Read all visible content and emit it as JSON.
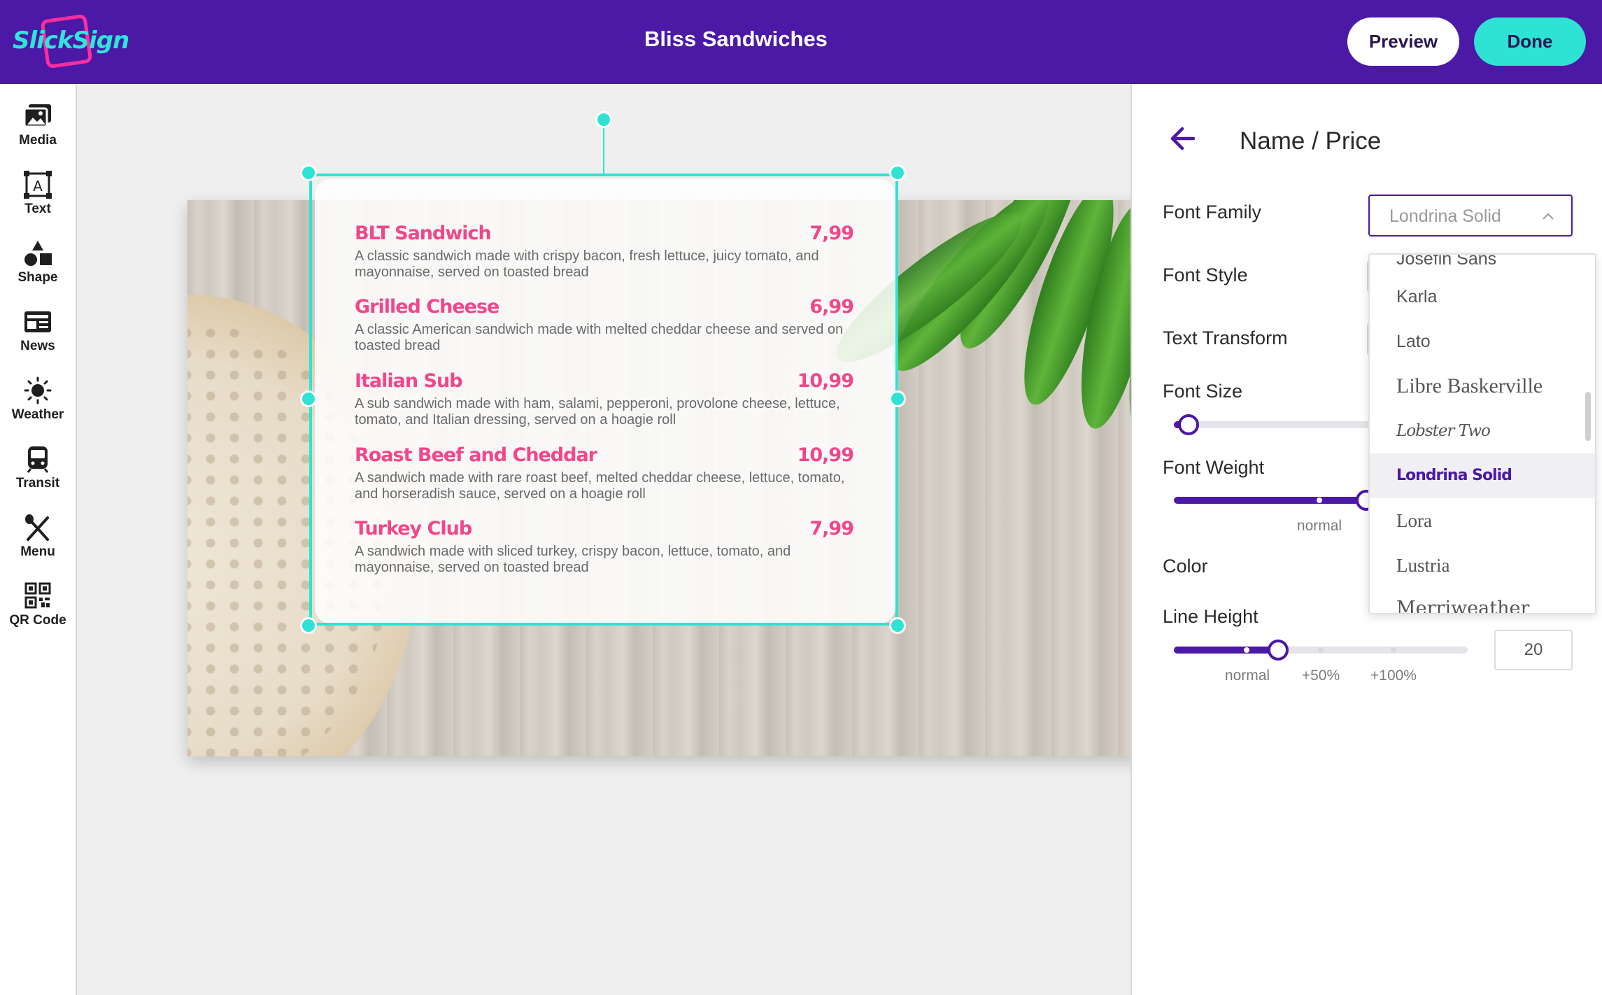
{
  "app": {
    "logo_text": "SlickSign",
    "title": "Bliss Sandwiches",
    "preview_label": "Preview",
    "done_label": "Done"
  },
  "sidebar": {
    "items": [
      {
        "label": "Media",
        "icon": "media-icon"
      },
      {
        "label": "Text",
        "icon": "text-icon"
      },
      {
        "label": "Shape",
        "icon": "shape-icon"
      },
      {
        "label": "News",
        "icon": "news-icon"
      },
      {
        "label": "Weather",
        "icon": "weather-icon"
      },
      {
        "label": "Transit",
        "icon": "transit-icon"
      },
      {
        "label": "Menu",
        "icon": "menu-icon"
      },
      {
        "label": "QR Code",
        "icon": "qr-code-icon"
      }
    ]
  },
  "menu": {
    "items": [
      {
        "name": "BLT Sandwich",
        "price": "7,99",
        "description": "A classic sandwich made with crispy bacon, fresh lettuce, juicy tomato, and mayonnaise, served on toasted bread"
      },
      {
        "name": "Grilled Cheese",
        "price": "6,99",
        "description": "A classic American sandwich made with melted cheddar cheese and served on toasted bread"
      },
      {
        "name": "Italian Sub",
        "price": "10,99",
        "description": "A sub sandwich made with ham, salami, pepperoni, provolone cheese, lettuce, tomato, and Italian dressing, served on a hoagie roll"
      },
      {
        "name": "Roast Beef and Cheddar",
        "price": "10,99",
        "description": "A sandwich made with rare roast beef, melted cheddar cheese, lettuce, tomato, and horseradish sauce, served on a hoagie roll"
      },
      {
        "name": "Turkey Club",
        "price": "7,99",
        "description": "A sandwich made with sliced turkey, crispy bacon, lettuce, tomato, and mayonnaise, served on toasted bread"
      }
    ]
  },
  "panel": {
    "title": "Name / Price",
    "font_family_label": "Font Family",
    "font_family_value": "Londrina Solid",
    "font_style_label": "Font Style",
    "text_transform_label": "Text Transform",
    "font_size_label": "Font Size",
    "font_weight_label": "Font Weight",
    "font_weight_scale": [
      "normal"
    ],
    "color_label": "Color",
    "line_height_label": "Line Height",
    "line_height_scale": [
      "normal",
      "+50%",
      "+100%"
    ],
    "line_height_value": "20"
  },
  "font_dropdown": {
    "options": [
      "Josefin Sans",
      "Karla",
      "Lato",
      "Libre Baskerville",
      "Lobster Two",
      "Londrina Solid",
      "Lora",
      "Lustria",
      "Merriweather"
    ],
    "selected": "Londrina Solid"
  },
  "colors": {
    "brand": "#4c18a6",
    "accent": "#2ee3d4",
    "menu_name": "#f2468a"
  }
}
